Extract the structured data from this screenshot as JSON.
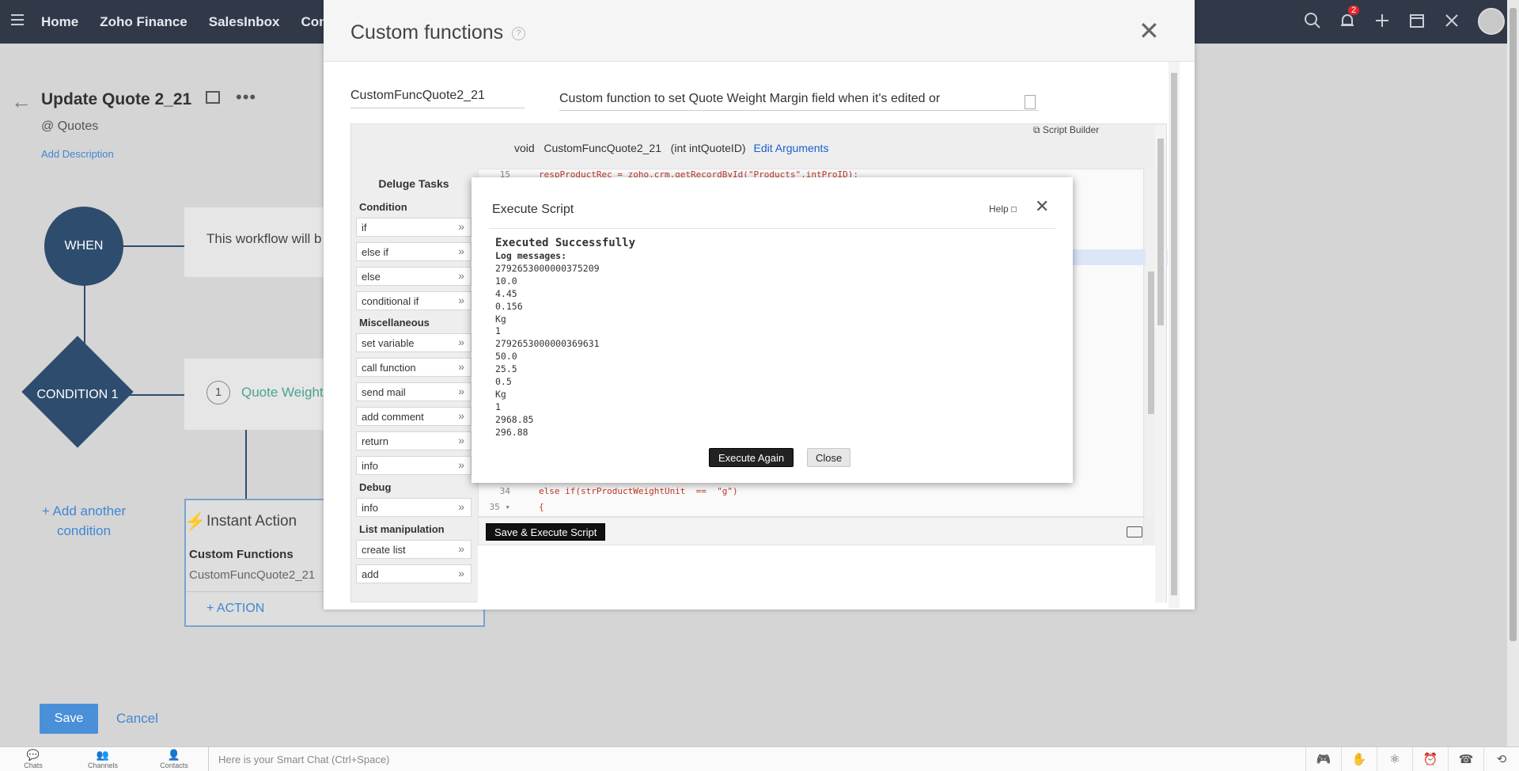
{
  "topnav": {
    "items": [
      "Home",
      "Zoho Finance",
      "SalesInbox",
      "Conta"
    ],
    "notification_count": "2"
  },
  "workflow": {
    "title": "Update Quote 2_21",
    "module": "@ Quotes",
    "add_description": "Add Description",
    "when_label": "WHEN",
    "condition_label": "CONDITION 1",
    "trigger_text": "This workflow will b",
    "condition_num": "1",
    "condition_text": "Quote Weight",
    "add_condition": "+ Add another condition",
    "instant_actions": "Instant Action",
    "custom_functions_heading": "Custom Functions",
    "function_name": "CustomFuncQuote2_21",
    "add_action": "+ ACTION",
    "save": "Save",
    "cancel": "Cancel"
  },
  "bottombar": {
    "items": [
      "Chats",
      "Channels",
      "Contacts"
    ],
    "smartchat_placeholder": "Here is your Smart Chat (Ctrl+Space)"
  },
  "custom_functions_modal": {
    "title": "Custom functions",
    "help_symbol": "?",
    "function_name": "CustomFuncQuote2_21",
    "description": "Custom function to set Quote Weight Margin field when it's edited or",
    "script_builder": "Script Builder",
    "signature_void": "void",
    "signature_name": "CustomFuncQuote2_21",
    "signature_args": "(int intQuoteID)",
    "edit_arguments": "Edit Arguments",
    "palette_title": "Deluge Tasks",
    "palette_sections": [
      {
        "name": "Condition",
        "items": [
          "if",
          "else if",
          "else",
          "conditional if"
        ]
      },
      {
        "name": "Miscellaneous",
        "items": [
          "set variable",
          "call function",
          "send mail",
          "add comment",
          "return",
          "info"
        ]
      },
      {
        "name": "Debug",
        "items": [
          "info"
        ]
      },
      {
        "name": "List manipulation",
        "items": [
          "create list",
          "add"
        ]
      }
    ],
    "code_lines": [
      {
        "num": "15",
        "text": "respProductRec = zoho.crm.getRecordById(\"Products\",intProID);"
      },
      {
        "num": "34",
        "text": "else if(strProductWeightUnit  ==  \"g\")"
      },
      {
        "num": "35 ▾",
        "text": "{"
      }
    ],
    "save_execute": "Save & Execute Script"
  },
  "execute_dialog": {
    "title": "Execute Script",
    "help": "Help",
    "status": "Executed Successfully",
    "log_label": "Log messages:",
    "log_lines": [
      "2792653000000375209",
      "10.0",
      "4.45",
      "0.156",
      "Kg",
      "1",
      "2792653000000369631",
      "50.0",
      "25.5",
      "0.5",
      "Kg",
      "1",
      "2968.85",
      "296.88"
    ],
    "execute_again": "Execute Again",
    "close": "Close"
  }
}
